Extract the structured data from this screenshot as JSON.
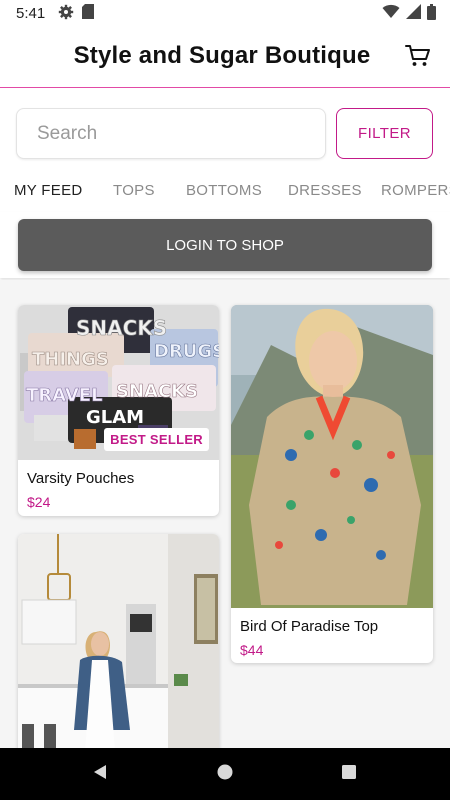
{
  "status_bar": {
    "time": "5:41",
    "icons": [
      "gear-icon",
      "sd-card-icon",
      "wifi-icon",
      "signal-icon",
      "battery-icon"
    ]
  },
  "header": {
    "title": "Style and Sugar Boutique",
    "cart_icon": "cart-icon"
  },
  "search": {
    "placeholder": "Search",
    "value": "",
    "filter_label": "FILTER"
  },
  "tabs": [
    {
      "label": "MY FEED",
      "active": true
    },
    {
      "label": "TOPS",
      "active": false
    },
    {
      "label": "BOTTOMS",
      "active": false
    },
    {
      "label": "DRESSES",
      "active": false
    },
    {
      "label": "ROMPERS",
      "active": false
    }
  ],
  "login": {
    "label": "LOGIN TO SHOP"
  },
  "products": [
    {
      "name": "Varsity Pouches",
      "price": "$24",
      "badge": "BEST SELLER",
      "image": "product-photo-pouches",
      "pouch_labels": [
        "SNACKS",
        "THINGS",
        "DRUGS",
        "TRAVEL",
        "SNACKS",
        "GLAM"
      ]
    },
    {
      "name": "Bird Of Paradise Top",
      "price": "$44",
      "image": "product-photo-model-top"
    },
    {
      "name": "",
      "price": "",
      "image": "product-photo-model-kitchen"
    }
  ],
  "colors": {
    "accent": "#c21a88",
    "header_rule": "#e24aa6",
    "login_button": "#5b5b5b",
    "feed_background": "#f5f5f5"
  },
  "nav": {
    "icons": [
      "back-icon",
      "home-icon",
      "recents-icon"
    ]
  }
}
